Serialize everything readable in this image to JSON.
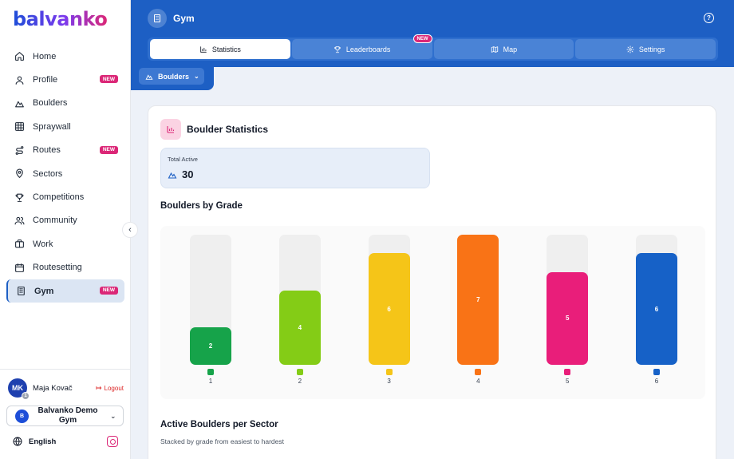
{
  "brand": {
    "logo_text": "balvanko"
  },
  "sidebar": {
    "items": [
      {
        "label": "Home",
        "icon": "home-icon",
        "new": false,
        "active": false
      },
      {
        "label": "Profile",
        "icon": "user-icon",
        "new": true,
        "active": false
      },
      {
        "label": "Boulders",
        "icon": "mountain-icon",
        "new": false,
        "active": false
      },
      {
        "label": "Spraywall",
        "icon": "grid-icon",
        "new": false,
        "active": false
      },
      {
        "label": "Routes",
        "icon": "route-icon",
        "new": true,
        "active": false
      },
      {
        "label": "Sectors",
        "icon": "map-pin-icon",
        "new": false,
        "active": false
      },
      {
        "label": "Competitions",
        "icon": "trophy-icon",
        "new": false,
        "active": false
      },
      {
        "label": "Community",
        "icon": "users-icon",
        "new": false,
        "active": false
      },
      {
        "label": "Work",
        "icon": "briefcase-icon",
        "new": false,
        "active": false
      },
      {
        "label": "Routesetting",
        "icon": "calendar-icon",
        "new": false,
        "active": false
      },
      {
        "label": "Gym",
        "icon": "building-icon",
        "new": true,
        "active": true
      }
    ],
    "new_badge": "NEW",
    "user": {
      "initials": "MK",
      "badge_count": "1",
      "name": "Maja Kovač",
      "logout_label": "Logout"
    },
    "gym_selector": {
      "initial": "B",
      "name": "Balvanko Demo Gym"
    },
    "language": "English"
  },
  "header": {
    "title": "Gym",
    "tabs": [
      {
        "label": "Statistics",
        "icon": "bar-chart-icon",
        "active": true,
        "new": false
      },
      {
        "label": "Leaderboards",
        "icon": "trophy-icon",
        "active": false,
        "new": true
      },
      {
        "label": "Map",
        "icon": "map-icon",
        "active": false,
        "new": false
      },
      {
        "label": "Settings",
        "icon": "gear-icon",
        "active": false,
        "new": false
      }
    ],
    "tab_new_badge": "NEW",
    "sub_filter": "Boulders"
  },
  "main": {
    "stats_title": "Boulder Statistics",
    "total_active_label": "Total Active",
    "total_active_value": "30",
    "grade_section_title": "Boulders by Grade",
    "sector_section_title": "Active Boulders per Sector",
    "sector_section_subtitle": "Stacked by grade from easiest to hardest"
  },
  "colors": {
    "primary": "#1d5fc4",
    "new_badge": "#db2777",
    "grade_colors": [
      "#16a34a",
      "#84cc16",
      "#f5c518",
      "#f97316",
      "#e91e7a",
      "#1661c7"
    ]
  },
  "chart_data": {
    "type": "bar",
    "categories": [
      "1",
      "2",
      "3",
      "4",
      "5",
      "6"
    ],
    "values": [
      2,
      4,
      6,
      7,
      5,
      6
    ],
    "ylim": [
      0,
      7
    ],
    "xlabel": "",
    "ylabel": ""
  }
}
